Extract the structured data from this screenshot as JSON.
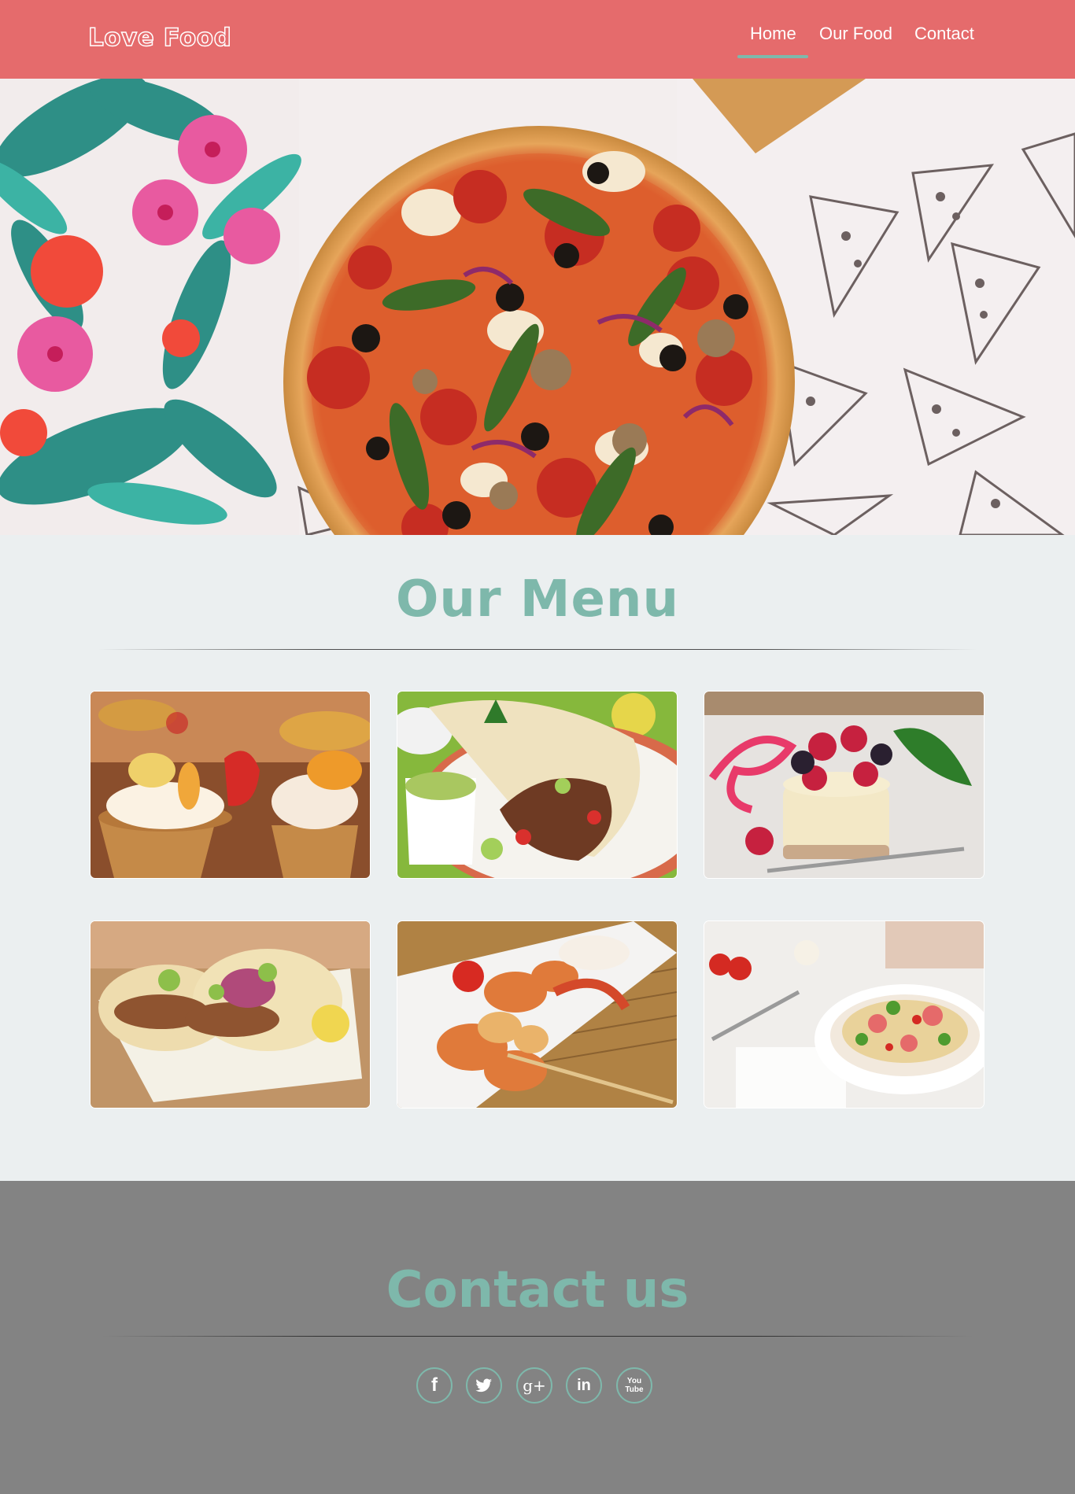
{
  "header": {
    "brand": "Love Food",
    "nav": [
      {
        "label": "Home",
        "active": true
      },
      {
        "label": "Our Food",
        "active": false
      },
      {
        "label": "Contact",
        "active": false
      }
    ]
  },
  "menu": {
    "title": "Our Menu",
    "items": [
      {
        "image": "fruit-tarts-image"
      },
      {
        "image": "burrito-image"
      },
      {
        "image": "cheesecake-berries-image"
      },
      {
        "image": "tacos-image"
      },
      {
        "image": "grilled-seafood-image"
      },
      {
        "image": "pasta-salad-image"
      }
    ]
  },
  "contact": {
    "title": "Contact us",
    "social": [
      {
        "icon": "facebook-icon",
        "glyph": "f"
      },
      {
        "icon": "twitter-icon",
        "glyph": "t"
      },
      {
        "icon": "google-plus-icon",
        "glyph": "g+"
      },
      {
        "icon": "linkedin-icon",
        "glyph": "in"
      },
      {
        "icon": "youtube-icon",
        "glyph": "You Tube"
      }
    ]
  },
  "colors": {
    "header": "#e56b6c",
    "accent": "#7eb8ab",
    "page_bg": "#ebeff0",
    "footer_bg": "#838383"
  }
}
